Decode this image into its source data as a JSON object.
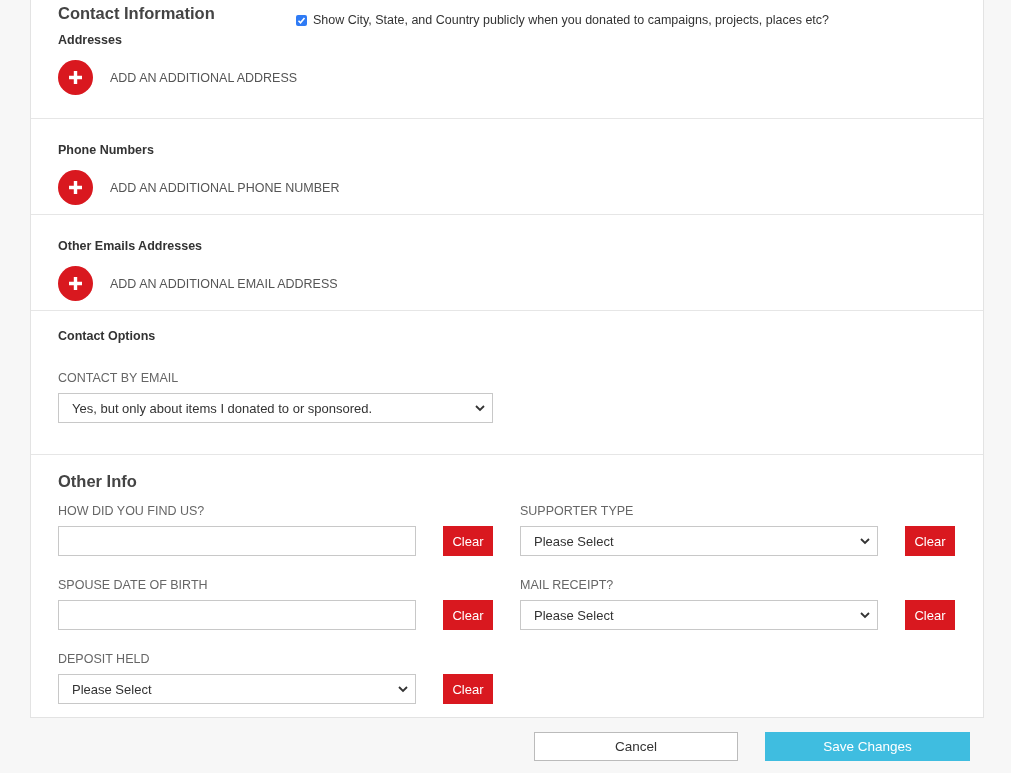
{
  "sections": [
    {
      "heading": "Contact Information",
      "checkbox": {
        "label": "Show City, State, and Country publicly when you donated to campaigns, projects, places etc?",
        "checked": true
      },
      "title": "Addresses",
      "action": "ADD AN ADDITIONAL ADDRESS"
    },
    {
      "title": "Phone Numbers",
      "action": "ADD AN ADDITIONAL PHONE NUMBER"
    },
    {
      "title": "Other Emails Addresses",
      "action": "ADD AN ADDITIONAL EMAIL ADDRESS"
    }
  ],
  "contact_options": {
    "title": "Contact Options",
    "fields": [
      {
        "label": "CONTACT BY EMAIL",
        "kind": "select",
        "value": "Yes, but only about items I donated to or sponsored."
      }
    ]
  },
  "other_info": {
    "title": "Other Info",
    "fields": [
      {
        "label": "HOW DID YOU FIND US?",
        "kind": "text",
        "clear": "Clear"
      },
      {
        "label": "SUPPORTER TYPE",
        "kind": "select",
        "value": "Please Select",
        "clear": "Clear"
      },
      {
        "label": "SPOUSE DATE OF BIRTH",
        "kind": "text",
        "clear": "Clear"
      },
      {
        "label": "MAIL RECEIPT?",
        "kind": "select",
        "value": "Please Select",
        "clear": "Clear"
      },
      {
        "label": "DEPOSIT HELD",
        "kind": "select",
        "value": "Please Select",
        "clear": "Clear"
      }
    ]
  },
  "buttons": [
    {
      "label": "Cancel",
      "kind": "secondary"
    },
    {
      "label": "Save Changes",
      "kind": "primary"
    }
  ]
}
